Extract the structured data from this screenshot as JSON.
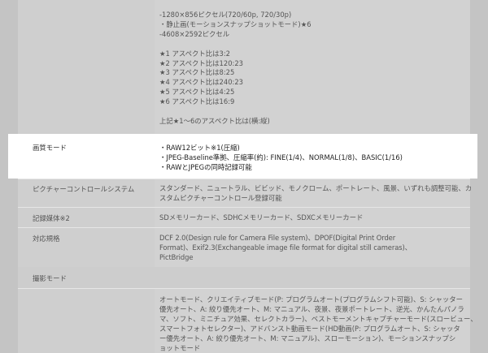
{
  "top_block": {
    "lines": [
      "-1280×856ピクセル(720/60p, 720/30p)",
      "・静止画(モーションスナップショットモード)★6",
      "-4608×2592ピクセル",
      "",
      "★1 アスペクト比は3:2",
      "★2 アスペクト比は120:23",
      "★3 アスペクト比は8:25",
      "★4 アスペクト比は240:23",
      "★5 アスペクト比は4:25",
      "★6 アスペクト比は16:9",
      "",
      "上記★1〜6のアスペクト比は(横:縦)"
    ]
  },
  "image_quality": {
    "label": "画質モード",
    "lines": [
      "・RAW12ビット※1(圧縮)",
      "・JPEG-Baseline準拠、圧縮率(約): FINE(1/4)、NORMAL(1/8)、BASIC(1/16)",
      "・RAWとJPEGの同時記録可能"
    ]
  },
  "picture_control": {
    "label": "ピクチャーコントロールシステム",
    "lines": [
      "スタンダード、ニュートラル、ビビッド、モノクローム、ポートレート、風景、いずれも調整可能、カ",
      "スタムピクチャーコントロール登録可能"
    ]
  },
  "media": {
    "label": "記録媒体※2",
    "lines": [
      "SDメモリーカード、SDHCメモリーカード、SDXCメモリーカード"
    ]
  },
  "standards": {
    "label": "対応規格",
    "lines": [
      "DCF 2.0(Design rule for Camera File system)、DPOF(Digital Print Order",
      "Format)、Exif2.3(Exchangeable image file format for digital still cameras)、",
      "PictBridge"
    ]
  },
  "shooting_section": {
    "label": "撮影モード"
  },
  "shooting_modes": {
    "lines": [
      "オートモード、クリエイティブモード(P: プログラムオート(プログラムシフト可能)、S: シャッター",
      "優先オート、A: 絞り優先オート、M: マニュアル、夜景、夜景ポートレート、逆光、かんたんパノラ",
      "マ、ソフト、ミニチュア効果、セレクトカラー)、ベストモーメントキャプチャーモード(スロービュー、",
      "スマートフォトセレクター)、アドバンスト動画モード(HD動画(P: プログラムオート、S: シャッタ",
      "ー優先オート、A: 絞り優先オート、M: マニュアル)、スローモーション)、モーションスナップシ",
      "ョットモード"
    ]
  }
}
